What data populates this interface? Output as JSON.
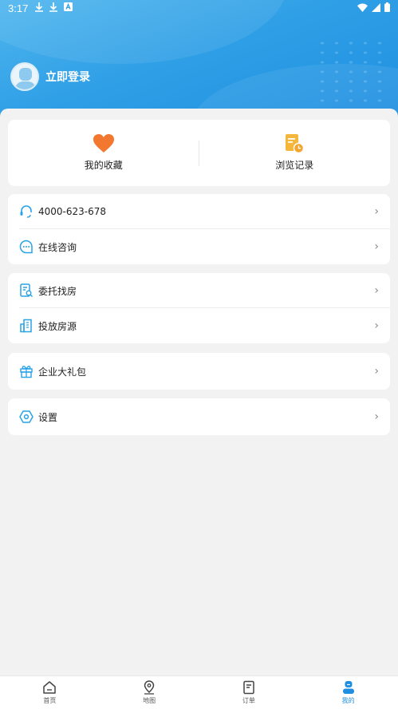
{
  "status_bar": {
    "time": "3:17"
  },
  "profile": {
    "login_text": "立即登录"
  },
  "quick_actions": [
    {
      "label": "我的收藏",
      "icon": "heart-icon",
      "color": "#f2772f"
    },
    {
      "label": "浏览记录",
      "icon": "history-doc-icon",
      "color": "#f5b73b"
    }
  ],
  "menu_groups": [
    {
      "items": [
        {
          "label": "4000-623-678",
          "icon": "headset-icon"
        },
        {
          "label": "在线咨询",
          "icon": "chat-bubble-icon"
        }
      ]
    },
    {
      "items": [
        {
          "label": "委托找房",
          "icon": "search-document-icon"
        },
        {
          "label": "投放房源",
          "icon": "building-icon"
        }
      ]
    },
    {
      "items": [
        {
          "label": "企业大礼包",
          "icon": "gift-icon"
        }
      ]
    },
    {
      "items": [
        {
          "label": "设置",
          "icon": "settings-icon"
        }
      ]
    }
  ],
  "tabs": [
    {
      "label": "首页",
      "icon": "home-icon",
      "active": false
    },
    {
      "label": "地图",
      "icon": "map-pin-icon",
      "active": false
    },
    {
      "label": "订单",
      "icon": "order-icon",
      "active": false
    },
    {
      "label": "我的",
      "icon": "profile-icon",
      "active": true
    }
  ],
  "colors": {
    "accent": "#1e8fe0",
    "icon_blue": "#29a3e6"
  },
  "arrow_glyph": "›"
}
